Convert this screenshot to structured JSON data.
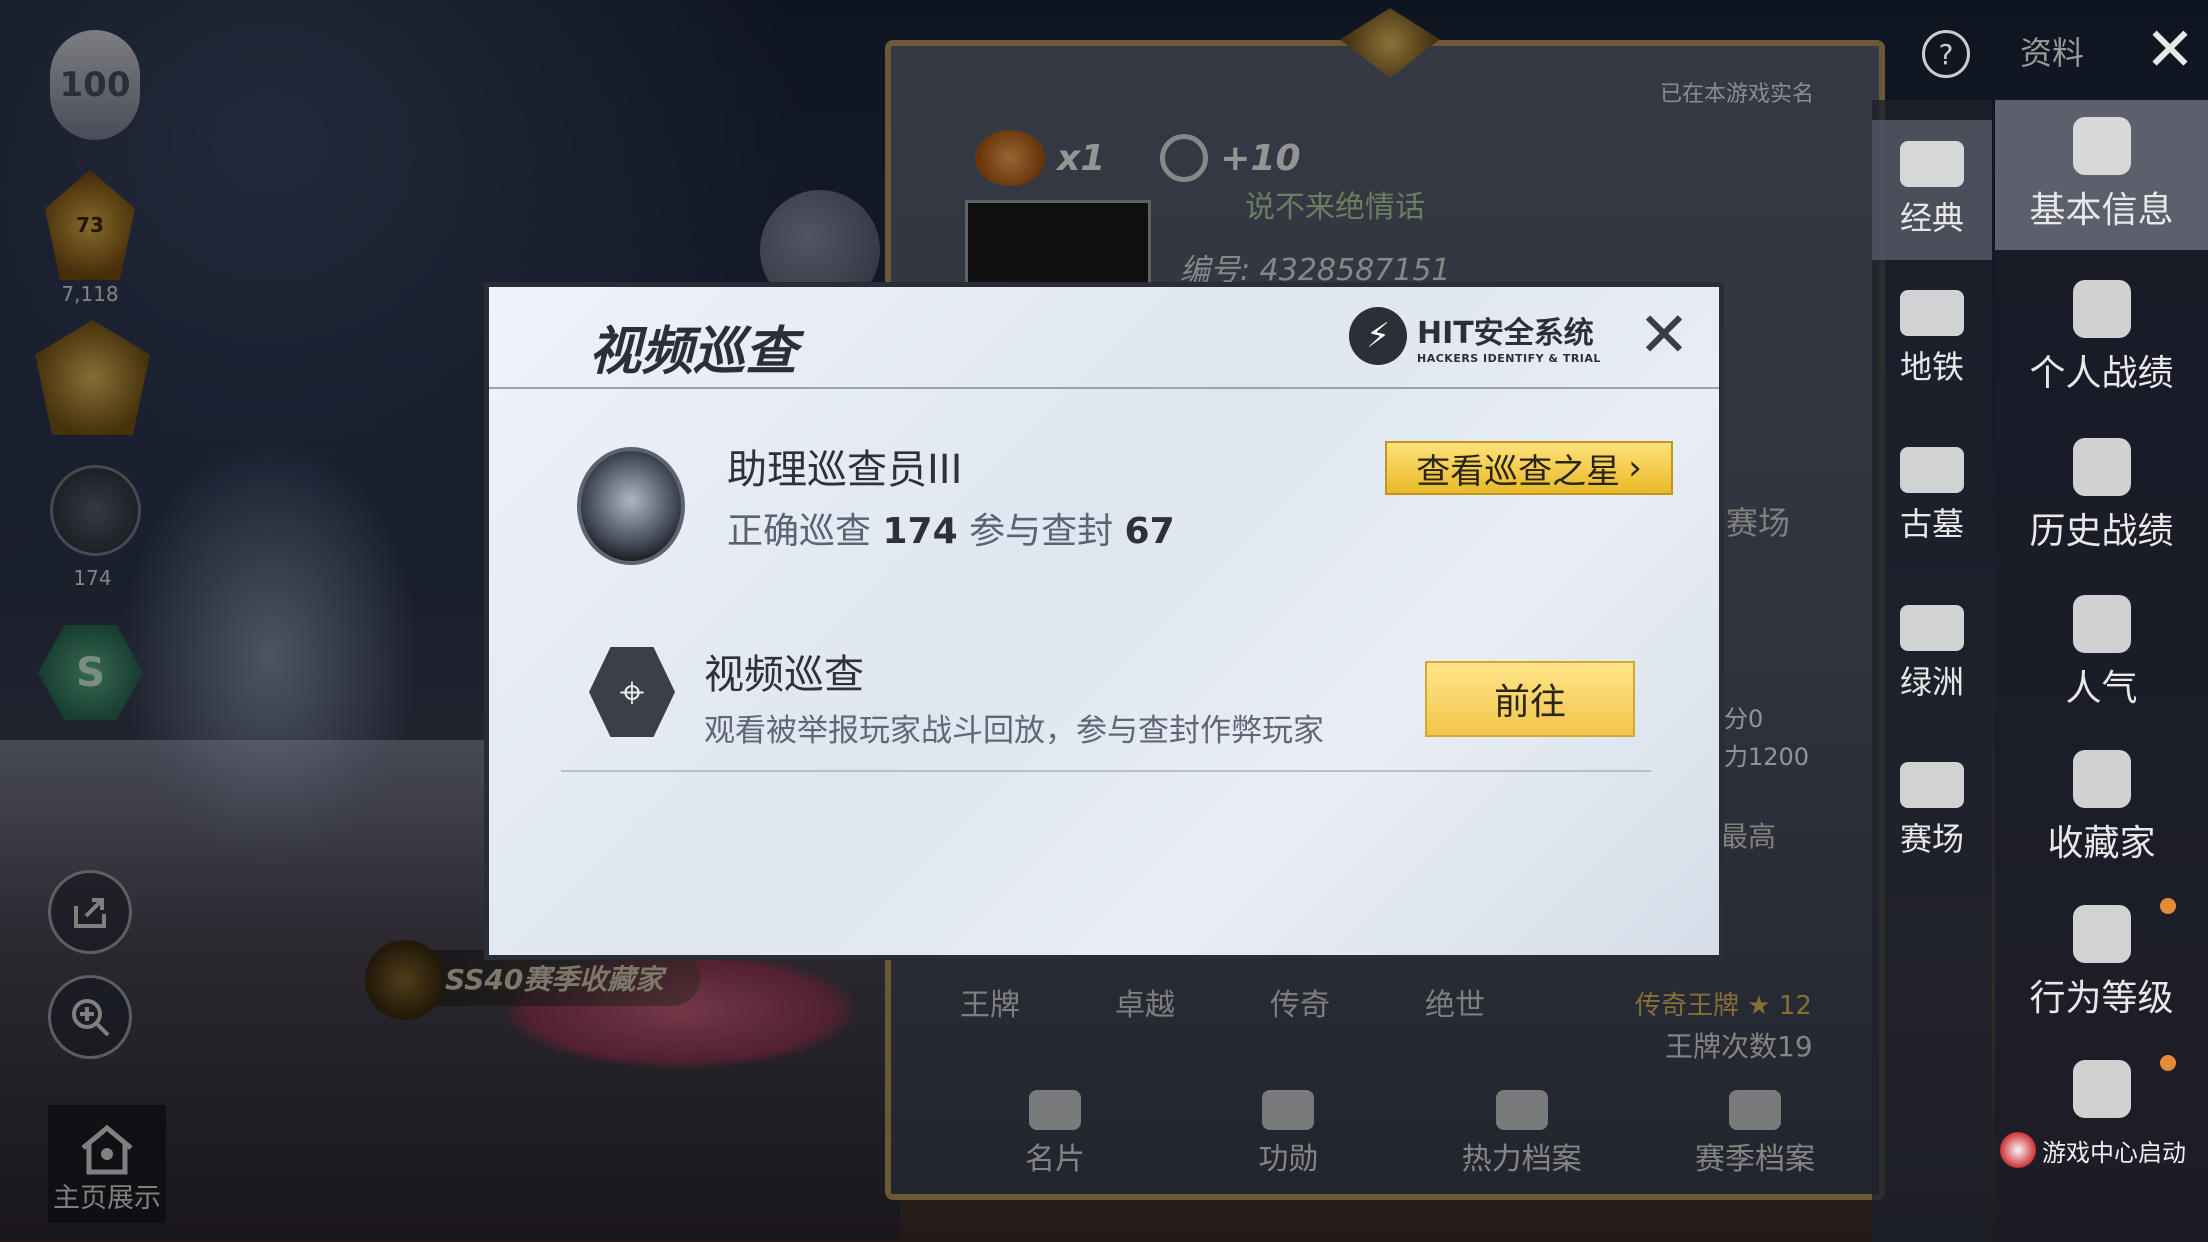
{
  "left_panel": {
    "level_emblem_text": "100",
    "tier_badge_1_value": "73",
    "tier_badge_1_count": "7,118",
    "patrol_badge_count": "174",
    "season_hex_letter": "S",
    "collector_tag": "SS40赛季收藏家",
    "home_display_label": "主页展示"
  },
  "profile_card": {
    "realname_note": "已在本游戏实名",
    "rewards": [
      {
        "icon": "chicken-dinner-icon",
        "value": "x1"
      },
      {
        "icon": "popularity-icon",
        "value": "+10"
      }
    ],
    "signature": "说不来绝情话",
    "player_id": "编号: 4328587151",
    "arena_label": "赛场",
    "stats_lines": [
      "积分0",
      "战力1200"
    ],
    "highest_label": "最高",
    "tier_labels": [
      "王牌",
      "卓越",
      "传奇",
      "绝世"
    ],
    "legend_ace": "传奇王牌 ★ 12",
    "ace_count": "王牌次数19",
    "bottom_tabs": [
      "名片",
      "功勋",
      "热力档案",
      "赛季档案"
    ]
  },
  "top_bar": {
    "help": "?",
    "title": "资料",
    "close": "✕"
  },
  "mode_column": [
    "经典",
    "地铁",
    "古墓",
    "绿洲",
    "赛场"
  ],
  "profile_column": [
    "基本信息",
    "个人战绩",
    "历史战绩",
    "人气",
    "收藏家",
    "行为等级"
  ],
  "game_center_label": "游戏中心启动",
  "modal": {
    "title": "视频巡查",
    "logo_title": "HIT安全系统",
    "logo_subtitle": "HACKERS IDENTIFY & TRIAL",
    "close": "✕",
    "patroller_rank": "助理巡查员III",
    "correct_label": "正确巡查",
    "correct_value": "174",
    "ban_label": "参与查封",
    "ban_value": "67",
    "patrol_star_button": "查看巡查之星",
    "video_patrol_title": "视频巡查",
    "video_patrol_desc": "观看被举报玩家战斗回放，参与查封作弊玩家",
    "goto_button": "前往"
  },
  "colors": {
    "accent_gold": "#f2c44a",
    "frame_gold": "#b59a5a",
    "modal_bg": "#e6ecf4"
  }
}
